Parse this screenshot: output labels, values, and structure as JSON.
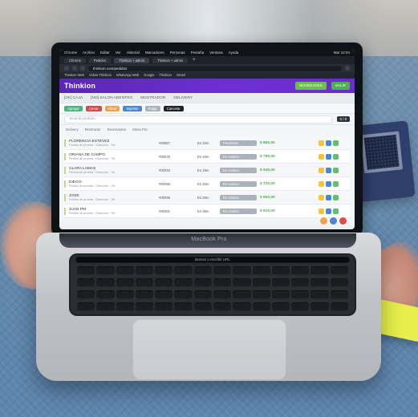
{
  "photo": {
    "laptop_label": "MacBook Pro"
  },
  "mac_menubar": {
    "items": [
      "Chrome",
      "Archivo",
      "Editar",
      "Ver",
      "Historial",
      "Marcadores",
      "Personas",
      "Pestaña",
      "Ventana",
      "Ayuda"
    ],
    "right_text": "Mar 12:04"
  },
  "browser": {
    "tabs": [
      "Chrome",
      "Pedidos",
      "Thinkion + admin",
      "Thinkion + admin"
    ],
    "url_text": "thinkion.com/pedidos",
    "bookmarks": [
      "Thinkion Web",
      "Volver Thinkion",
      "WhatsApp Web",
      "Google",
      "Thinkion",
      "Gmail"
    ]
  },
  "app": {
    "logo_text": "Thinkion",
    "header_buttons": [
      "NOVEDADES",
      "SALIR"
    ],
    "status_strip": [
      "[OK] CAJA",
      "[NO] SALON ADENTRO",
      "MOSTRADOR",
      "DELIVERY"
    ],
    "toolbar_chips": [
      "Agregar",
      "Cerrar",
      "Filtrar",
      "Imprimir",
      "Pagar",
      "Cancelar"
    ],
    "search_placeholder": "Buscar pedido...",
    "dark_pill": "0 / 8",
    "filters": [
      "Delivery",
      "Mostrador",
      "Reservados",
      "Mesa Pre"
    ],
    "rows": [
      {
        "name": "FLORENCIA ESTEVEZ",
        "sub": "Pedido de prueba · Dirección · Tel.",
        "id": "#00067",
        "time": "En 10m",
        "status": "Pendiente",
        "price": "$ 850,00"
      },
      {
        "name": "ORIANA DE CAMPO",
        "sub": "Pedido de prueba · Dirección · Tel.",
        "id": "#00079",
        "time": "En 10m",
        "status": "En camino",
        "price": "$ 780,00"
      },
      {
        "name": "CLARA LAMAS",
        "sub": "Pedido de prueba · Dirección · Tel.",
        "id": "#00253",
        "time": "En 15m",
        "status": "En camino",
        "price": "$ 940,00"
      },
      {
        "name": "DIEGO",
        "sub": "Pedido de prueba · Dirección · Tel.",
        "id": "#00255",
        "time": "En 20m",
        "status": "En camino",
        "price": "$ 720,00"
      },
      {
        "name": "JOSE",
        "sub": "Pedido de prueba · Dirección · Tel.",
        "id": "#00296",
        "time": "En 25m",
        "status": "En camino",
        "price": "$ 650,00"
      },
      {
        "name": "JUAN PM",
        "sub": "Pedido de prueba · Dirección · Tel.",
        "id": "#00301",
        "time": "En 35m",
        "status": "En camino",
        "price": "$ 610,00"
      }
    ]
  },
  "keyboard": {
    "touchbar_text": "Buscar o escribir URL"
  },
  "colors": {
    "brand_purple": "#6d2fd2",
    "success_green": "#4caf50",
    "accent_blue": "#4a86d6"
  }
}
